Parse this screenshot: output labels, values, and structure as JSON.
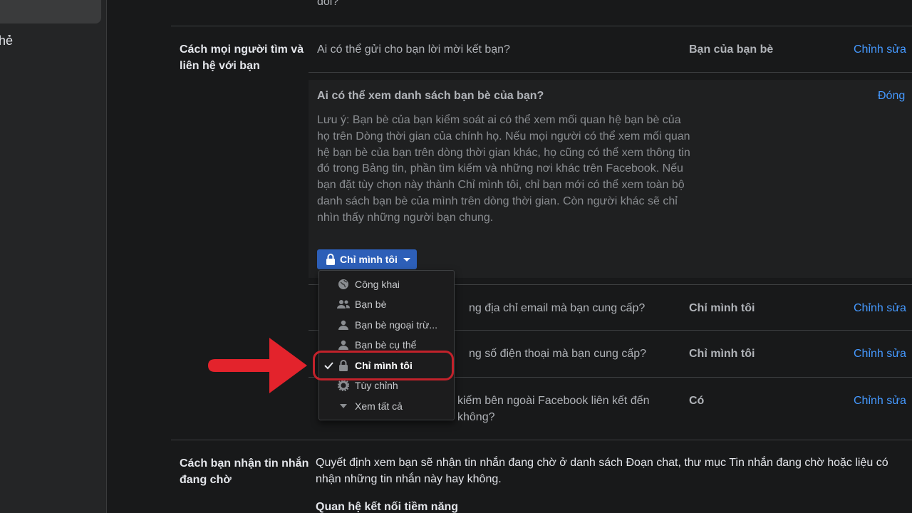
{
  "sidebar": {
    "partial_text": "hẻ"
  },
  "top": {
    "cut_text": "đổi?"
  },
  "section_find": {
    "title": "Cách mọi người tìm và liên hệ với bạn"
  },
  "rows": [
    {
      "question": "Ai có thể gửi cho bạn lời mời kết bạn?",
      "value": "Bạn của bạn bè",
      "edit": "Chỉnh sửa"
    },
    {
      "question_tail": "ng địa chỉ email mà bạn cung cấp?",
      "value": "Chỉ mình tôi",
      "edit": "Chỉnh sửa"
    },
    {
      "question_tail": "ng số điện thoại mà bạn cung cấp?",
      "value": "Chỉ mình tôi",
      "edit": "Chỉnh sửa"
    },
    {
      "question_line1_tail": "kiếm bên ngoài Facebook liên kết đến",
      "question_line2_tail": "không?",
      "value": "Có",
      "edit": "Chỉnh sửa"
    }
  ],
  "expanded": {
    "title": "Ai có thể xem danh sách bạn bè của bạn?",
    "close": "Đóng",
    "note": "Lưu ý: Bạn bè của bạn kiểm soát ai có thể xem mối quan hệ bạn bè của họ trên Dòng thời gian của chính họ. Nếu mọi người có thể xem mối quan hệ bạn bè của bạn trên dòng thời gian khác, họ cũng có thể xem thông tin đó trong Bảng tin, phần tìm kiếm và những nơi khác trên Facebook. Nếu bạn đặt tùy chọn này thành Chỉ mình tôi, chỉ bạn mới có thể xem toàn bộ danh sách bạn bè của mình trên dòng thời gian. Còn người khác sẽ chỉ nhìn thấy những người bạn chung.",
    "privacy_button": "Chỉ mình tôi"
  },
  "dropdown": {
    "items": [
      {
        "label": "Công khai",
        "icon": "globe-icon"
      },
      {
        "label": "Bạn bè",
        "icon": "friends-icon"
      },
      {
        "label": "Bạn bè ngoại trừ...",
        "icon": "friends-except-icon"
      },
      {
        "label": "Bạn bè cụ thể",
        "icon": "specific-friends-icon"
      },
      {
        "label": "Chỉ mình tôi",
        "icon": "lock-icon",
        "selected": true
      },
      {
        "label": "Tùy chỉnh",
        "icon": "gear-icon"
      },
      {
        "label": "Xem tất cả",
        "icon": "caret-down-icon"
      }
    ]
  },
  "section_messages": {
    "title": "Cách bạn nhận tin nhắn đang chờ",
    "description": "Quyết định xem bạn sẽ nhận tin nhắn đang chờ ở danh sách Đoạn chat, thư mục Tin nhắn đang chờ hoặc liệu có nhận những tin nhắn này hay không.",
    "subheading": "Quan hệ kết nối tiềm năng"
  },
  "colors": {
    "link": "#4599ff",
    "button": "#2d5fb8",
    "annotation": "#e3232c"
  }
}
